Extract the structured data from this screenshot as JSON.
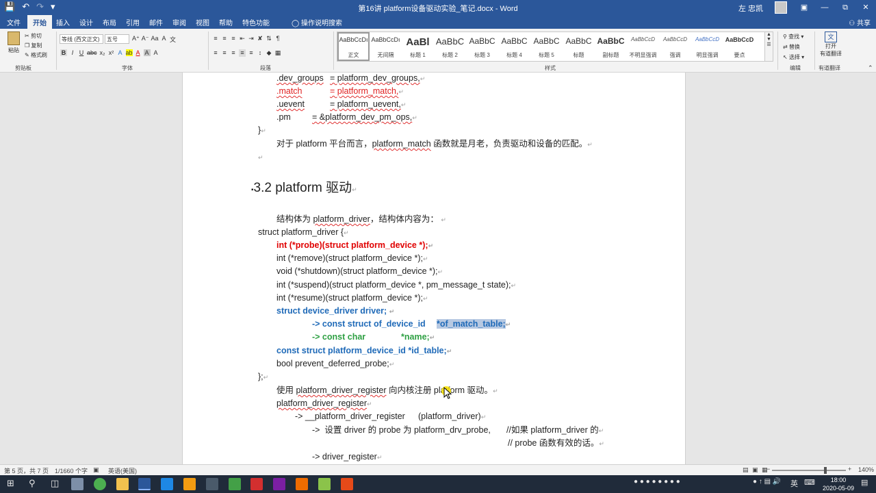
{
  "window": {
    "title": "第16讲 platform设备驱动实验_笔记.docx  -  Word",
    "user_name": "左 忠凯",
    "controls": [
      "—",
      "▭",
      "⧉",
      "✕"
    ]
  },
  "quick_access": {
    "save_icon": "save-icon",
    "undo_icon": "undo-icon",
    "redo_icon": "redo-icon"
  },
  "tabs": [
    "文件",
    "开始",
    "插入",
    "设计",
    "布局",
    "引用",
    "邮件",
    "审阅",
    "视图",
    "帮助",
    "特色功能"
  ],
  "active_tab": "开始",
  "tell_me": "操作说明搜索",
  "share": "共享",
  "ribbon": {
    "clipboard": {
      "paste": "粘贴",
      "cut": "剪切",
      "copy": "复制",
      "format_painter": "格式刷",
      "label": "剪贴板"
    },
    "font": {
      "font_name": "等线 (西文正文)",
      "font_size": "五号",
      "label": "字体",
      "glyphs_row1": [
        "A⁺",
        "A⁻",
        "Aa",
        "A",
        "文"
      ],
      "glyphs_row2": [
        "B",
        "I",
        "U",
        "abc",
        "x₂",
        "x²",
        "A",
        "ab",
        "A",
        "A",
        "A"
      ]
    },
    "paragraph": {
      "label": "段落"
    },
    "styles": {
      "label": "样式",
      "items": [
        {
          "sample": "AaBbCcDı",
          "name": "正文"
        },
        {
          "sample": "AaBbCcDı",
          "name": "无间隔"
        },
        {
          "sample": "AaBl",
          "name": "标题 1"
        },
        {
          "sample": "AaBbC",
          "name": "标题 2"
        },
        {
          "sample": "AaBbC",
          "name": "标题 3"
        },
        {
          "sample": "AaBbC",
          "name": "标题 4"
        },
        {
          "sample": "AaBbC",
          "name": "标题 5"
        },
        {
          "sample": "AaBbC",
          "name": "标题"
        },
        {
          "sample": "AaBbC",
          "name": "副标题"
        },
        {
          "sample": "AaBbCcD",
          "name": "不明显强调"
        },
        {
          "sample": "AaBbCcD",
          "name": "强调"
        },
        {
          "sample": "AaBbCcD",
          "name": "明显强调"
        },
        {
          "sample": "AaBbCcD",
          "name": "要点"
        }
      ]
    },
    "editing": {
      "find": "查找",
      "replace": "替换",
      "select": "选择",
      "label": "编辑"
    },
    "youdao": {
      "open": "打开",
      "line1": "有道翻译",
      "line2": "有道翻译"
    }
  },
  "document": {
    "top_lines": [
      {
        "field": ".dev_groups",
        "value": "= platform_dev_groups,"
      },
      {
        "field": ".match",
        "value": "= platform_match,"
      },
      {
        "field": ".uevent",
        "value": "= platform_uevent,"
      },
      {
        "field": ".pm",
        "value": "= &platform_dev_pm_ops,"
      }
    ],
    "closing1": "}",
    "para1_a": "对于 platform 平台而言，",
    "para1_b": "platform_match",
    "para1_c": " 函数就是月老，负责驱动和设备的匹配。",
    "heading": "3.2 platform 驱动",
    "intro_a": "结构体为 ",
    "intro_b": "platform_driver",
    "intro_c": "，结构体内容为：",
    "struct_open": "struct platform_driver {",
    "struct_lines": [
      "int (*probe)(struct platform_device *);",
      "int (*remove)(struct platform_device *);",
      "void (*shutdown)(struct platform_device *);",
      "int (*suspend)(struct platform_device *, pm_message_t state);",
      "int (*resume)(struct platform_device *);",
      "struct device_driver driver;",
      "-> const struct of_device_id",
      "*of_match_table;",
      "-> const char",
      "*name;",
      "const struct platform_device_id *id_table;",
      "bool prevent_deferred_probe;"
    ],
    "struct_close": "};",
    "register_a": "使用 ",
    "register_b": "platform_driver_register",
    "register_c": " 向内核注册 platform 驱动。",
    "call_chain": [
      "platform_driver_register",
      "-> __platform_driver_register",
      "(platform_driver)",
      "->  设置 driver 的 probe 为 platform_drv_probe,",
      "//如果 platform_driver 的",
      "// probe 函数有效的话。",
      "-> driver_register"
    ]
  },
  "status": {
    "page": "第 5 页，共 7 页",
    "words": "1/1660 个字",
    "language": "英语(美国)",
    "zoom": "140%",
    "zoom_fraction": 0.72
  },
  "taskbar": {
    "time": "18:00",
    "date": "2020-05-09",
    "ime": "英"
  }
}
